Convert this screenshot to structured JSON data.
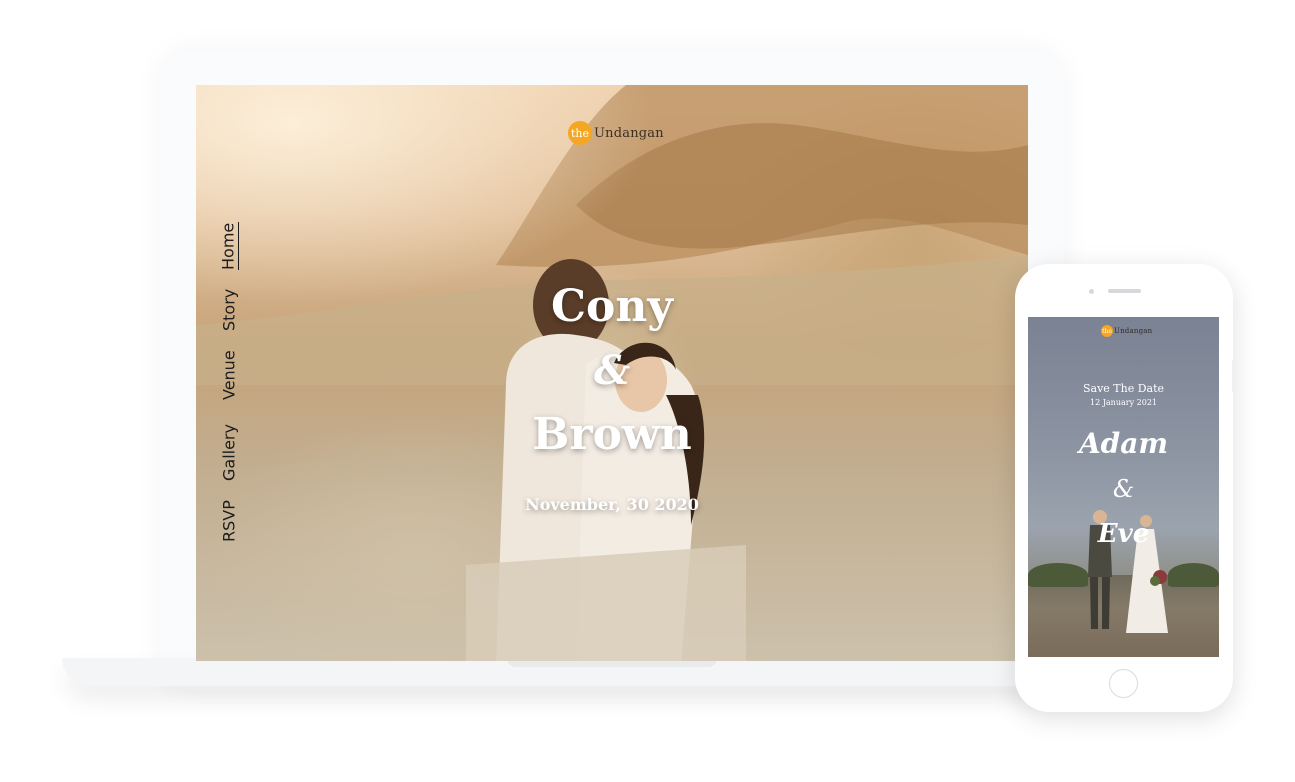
{
  "laptop": {
    "logo": {
      "prefix": "the",
      "word": "Undangan"
    },
    "nav": {
      "home": "Home",
      "story": "Story",
      "venue": "Venue",
      "gallery": "Gallery",
      "rsvp": "RSVP"
    },
    "hero": {
      "name1": "Cony",
      "ampersand": "&",
      "name2": "Brown",
      "date": "November, 30 2020"
    }
  },
  "phone": {
    "logo": {
      "prefix": "the",
      "word": "Undangan"
    },
    "save_the_date": "Save The Date",
    "date": "12 January 2021",
    "name1": "Adam",
    "ampersand": "&",
    "name2": "Eve"
  },
  "colors": {
    "logo_badge": "#f5a623",
    "nav_text": "#1d1d1d",
    "hero_text": "#ffffff"
  }
}
